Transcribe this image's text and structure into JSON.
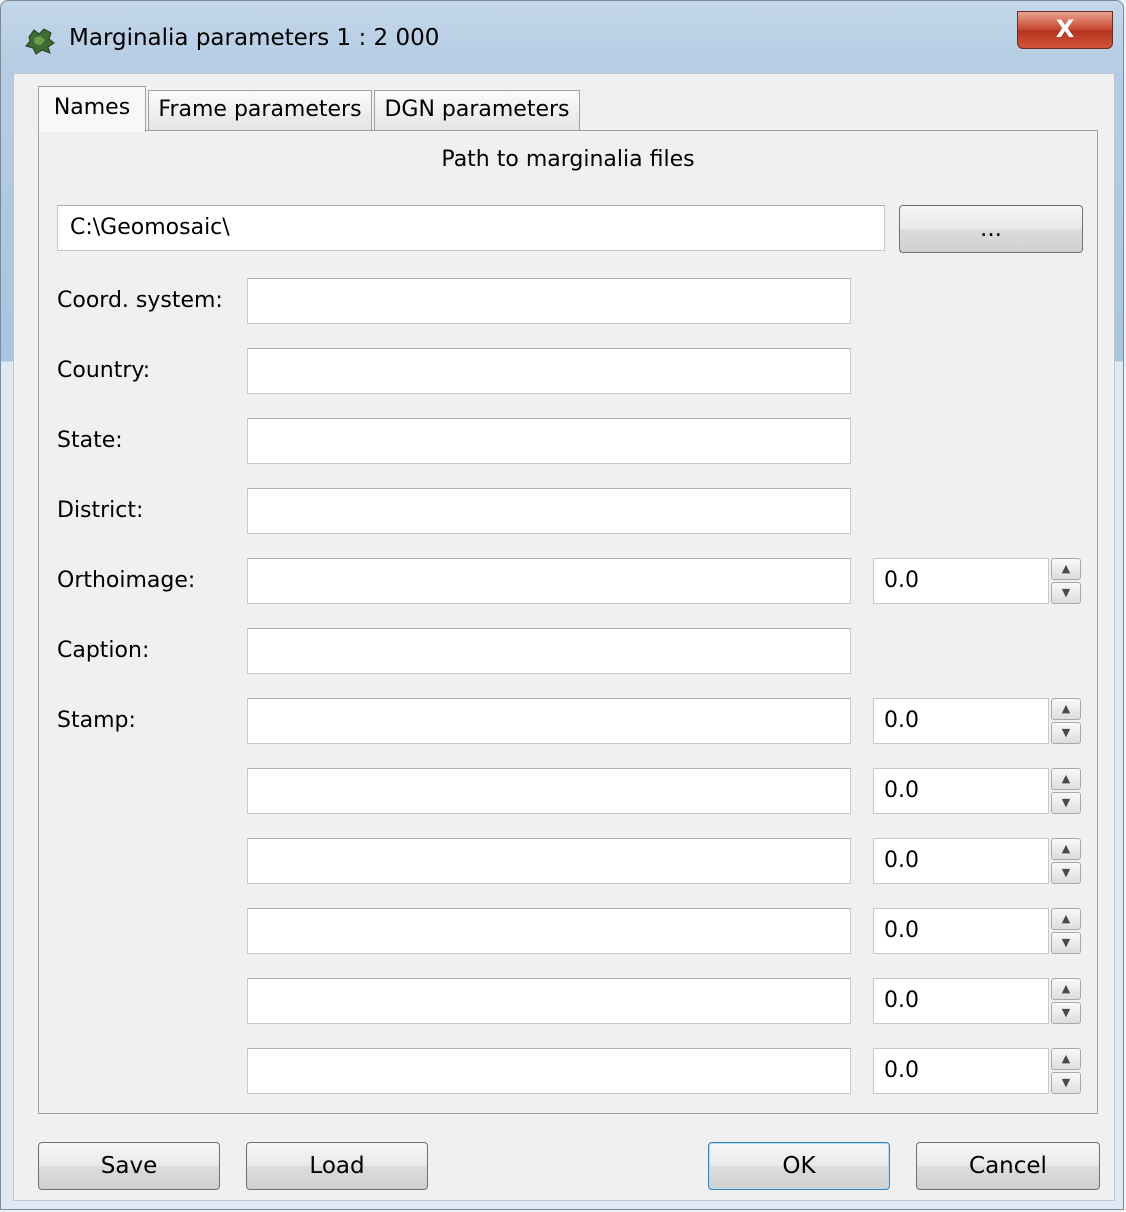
{
  "window": {
    "title": "Marginalia parameters 1 : 2 000",
    "close_label": "X"
  },
  "tabs": [
    {
      "label": "Names",
      "active": true
    },
    {
      "label": "Frame parameters",
      "active": false
    },
    {
      "label": "DGN parameters",
      "active": false
    }
  ],
  "names_tab": {
    "path_title": "Path to marginalia files",
    "path_value": "C:\\Geomosaic\\",
    "browse_label": "...",
    "fields": [
      {
        "label": "Coord. system:",
        "value": ""
      },
      {
        "label": "Country:",
        "value": ""
      },
      {
        "label": "State:",
        "value": ""
      },
      {
        "label": "District:",
        "value": ""
      },
      {
        "label": "Orthoimage:",
        "value": "",
        "spin": "0.0"
      },
      {
        "label": "Caption:",
        "value": ""
      },
      {
        "label": "Stamp:",
        "value": "",
        "spin": "0.0"
      },
      {
        "label": "",
        "value": "",
        "spin": "0.0"
      },
      {
        "label": "",
        "value": "",
        "spin": "0.0"
      },
      {
        "label": "",
        "value": "",
        "spin": "0.0"
      },
      {
        "label": "",
        "value": "",
        "spin": "0.0"
      },
      {
        "label": "",
        "value": "",
        "spin": "0.0"
      }
    ]
  },
  "footer": {
    "save_label": "Save",
    "load_label": "Load",
    "ok_label": "OK",
    "cancel_label": "Cancel"
  },
  "icons": {
    "app": "map-fragment-icon",
    "close": "close-icon",
    "spin_up": "spin-up-arrow-icon",
    "spin_down": "spin-down-arrow-icon"
  }
}
